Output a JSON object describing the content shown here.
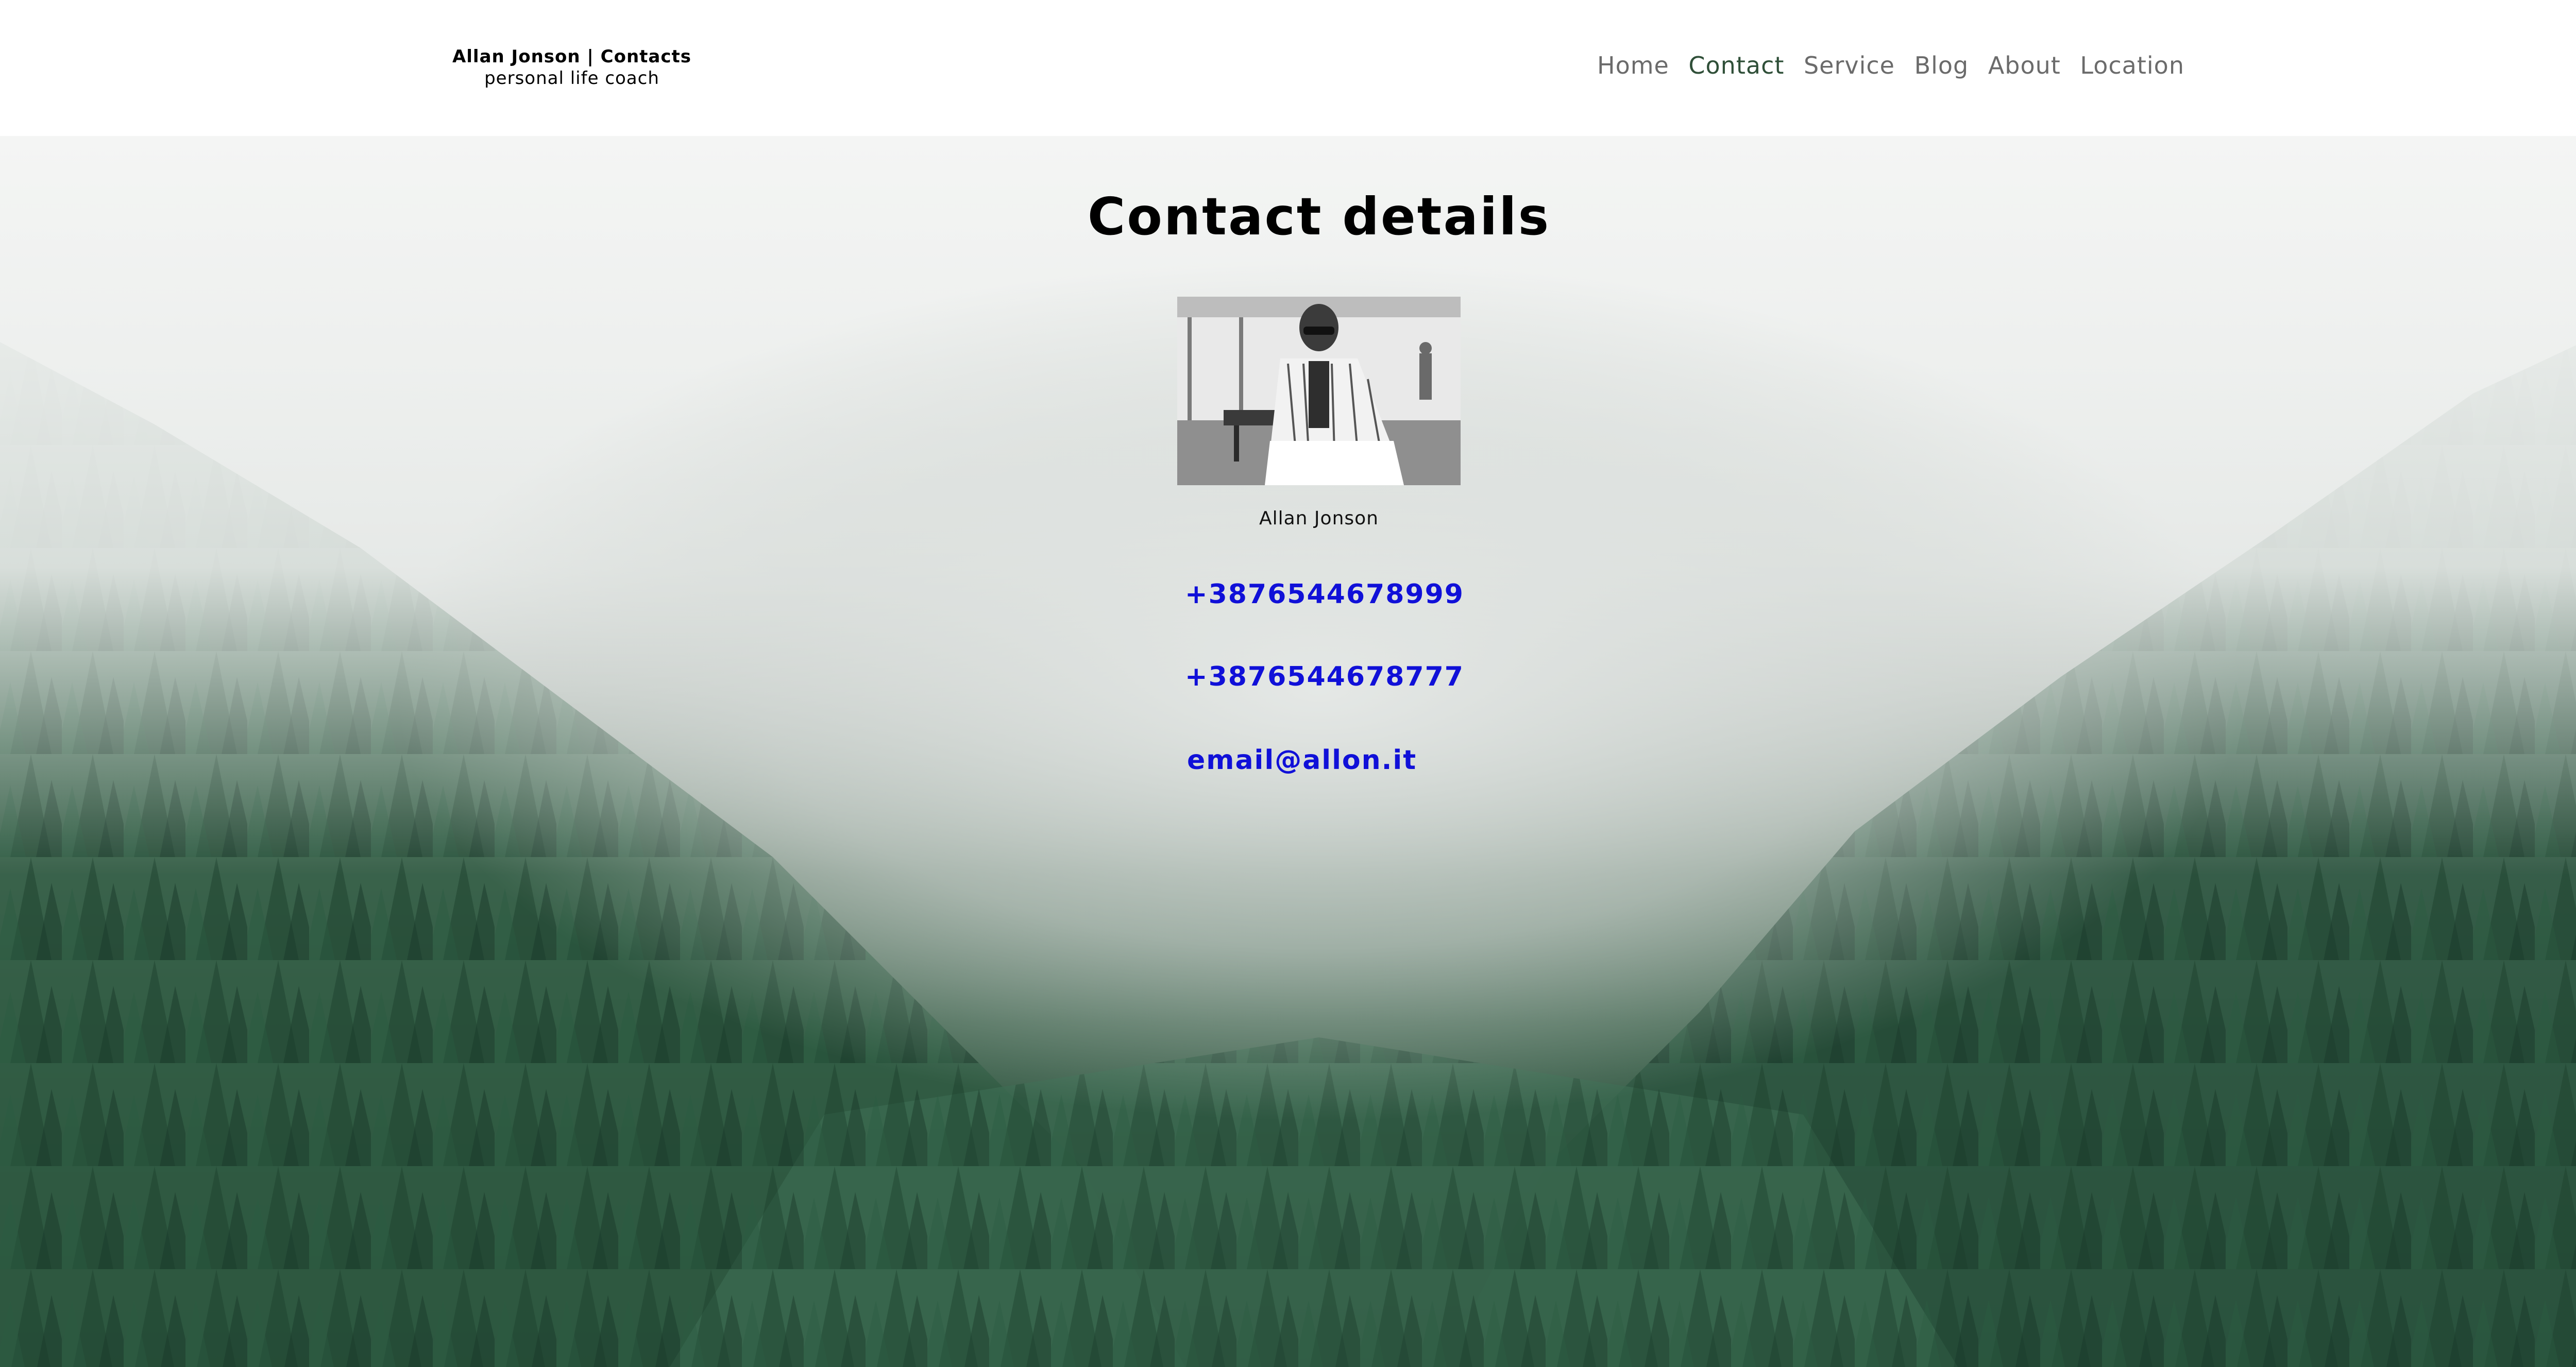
{
  "header": {
    "brand_title": "Allan Jonson | Contacts",
    "brand_subtitle": "personal life coach",
    "nav": [
      {
        "label": "Home",
        "active": false
      },
      {
        "label": "Contact",
        "active": true
      },
      {
        "label": "Service",
        "active": false
      },
      {
        "label": "Blog",
        "active": false
      },
      {
        "label": "About",
        "active": false
      },
      {
        "label": "Location",
        "active": false
      }
    ]
  },
  "main": {
    "title": "Contact details",
    "person_name": "Allan Jonson",
    "phone_1": "+3876544678999",
    "phone_2": "+3876544678777",
    "email": "email@allon.it"
  },
  "colors": {
    "link": "#1010d8",
    "nav_text": "#6b6b6b",
    "nav_active": "#2f4f38",
    "forest_dark": "#244634",
    "fog": "#eceeec"
  },
  "icons": {
    "hero_background": "misty-forest-image",
    "profile_photo": "man-in-sunglasses-photo"
  }
}
